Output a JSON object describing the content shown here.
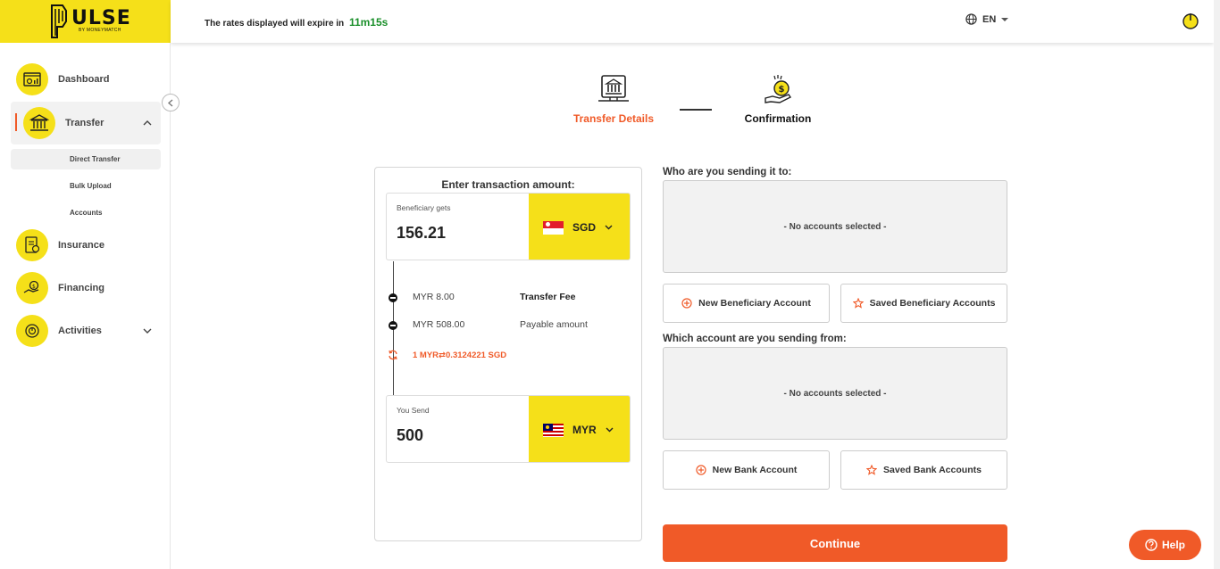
{
  "brand": {
    "name": "ULSE",
    "tagline": "BY MONEYMATCH"
  },
  "header": {
    "expiry_text": "The rates displayed will expire in",
    "timer": "11m15s",
    "language": "EN"
  },
  "sidebar": {
    "items": [
      {
        "label": "Dashboard",
        "icon": "dashboard-icon"
      },
      {
        "label": "Transfer",
        "icon": "bank-icon",
        "expanded": true
      },
      {
        "label": "Insurance",
        "icon": "insurance-icon"
      },
      {
        "label": "Financing",
        "icon": "financing-icon"
      },
      {
        "label": "Activities",
        "icon": "activities-icon"
      }
    ],
    "transfer_sub": [
      "Direct Transfer",
      "Bulk Upload",
      "Accounts"
    ]
  },
  "stepper": {
    "steps": [
      {
        "label": "Transfer Details",
        "active": true
      },
      {
        "label": "Confirmation",
        "active": false
      }
    ]
  },
  "amount_card": {
    "title": "Enter transaction amount:",
    "beneficiary": {
      "caption": "Beneficiary gets",
      "value": "156.21",
      "currency": "SGD"
    },
    "fee": {
      "amount": "MYR 8.00",
      "label": "Transfer Fee"
    },
    "payable": {
      "amount": "MYR 508.00",
      "label": "Payable amount"
    },
    "rate": {
      "from": "1 MYR",
      "to": "0.3124221 SGD"
    },
    "sender": {
      "caption": "You Send",
      "value": "500",
      "currency": "MYR"
    }
  },
  "beneficiary_section": {
    "title": "Who are you sending it to:",
    "empty_text": "- No accounts selected -",
    "new_button": "New Beneficiary Account",
    "saved_button": "Saved Beneficiary Accounts"
  },
  "source_section": {
    "title": "Which account are you sending from:",
    "empty_text": "- No accounts selected -",
    "new_button": "New Bank Account",
    "saved_button": "Saved Bank Accounts"
  },
  "actions": {
    "continue": "Continue",
    "help": "Help"
  },
  "colors": {
    "brand_yellow": "#f5e019",
    "accent_orange": "#f05a28",
    "timer_green": "#1a8f2a"
  }
}
